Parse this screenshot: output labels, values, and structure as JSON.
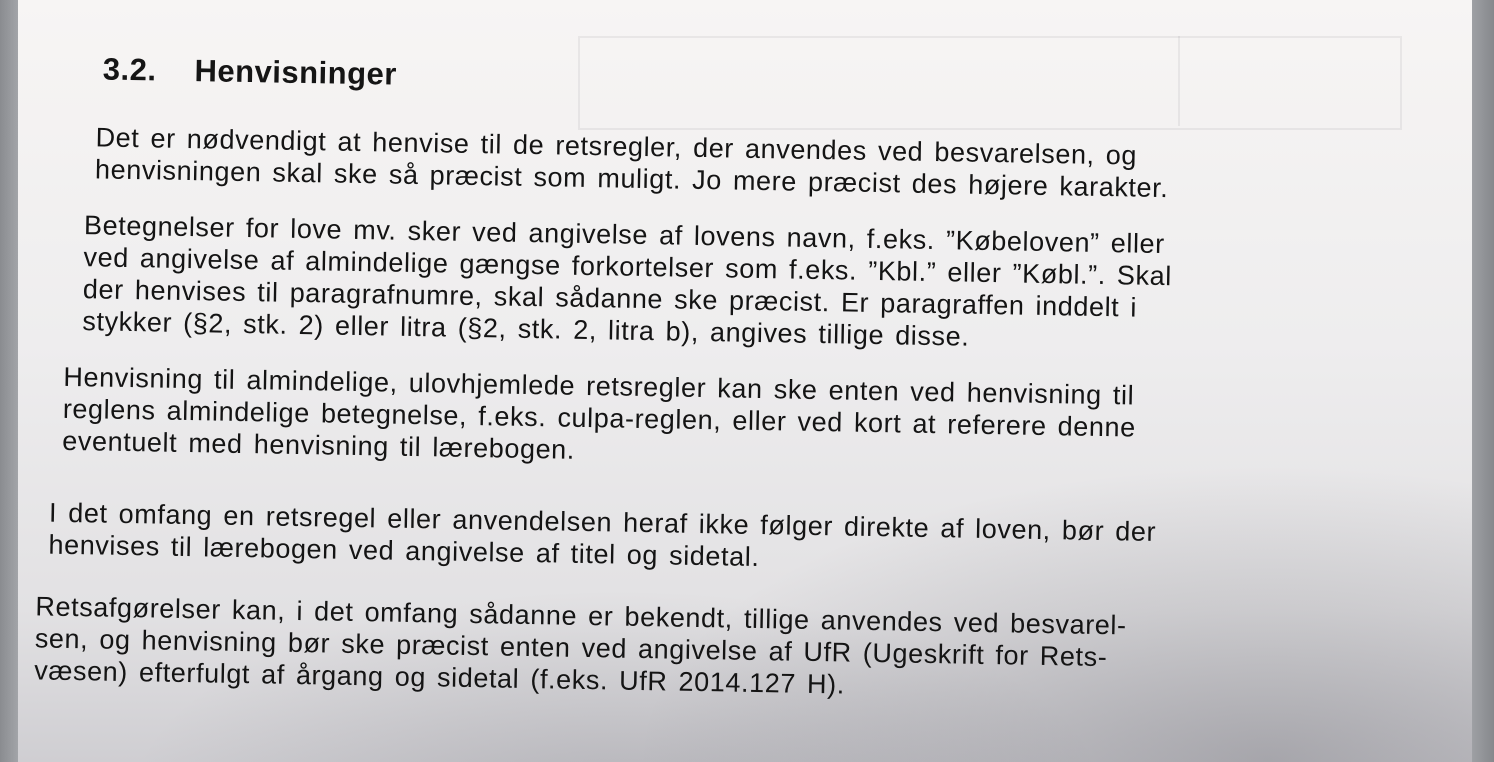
{
  "section": {
    "number": "3.2.",
    "title": "Henvisninger"
  },
  "paragraphs": [
    {
      "lines": [
        "Det er nødvendigt at henvise til de retsregler, der anvendes ved besvarelsen, og",
        "henvisningen skal ske så præcist som muligt. Jo mere præcist des højere karakter."
      ]
    },
    {
      "lines": [
        "Betegnelser for love mv. sker ved angivelse af lovens navn, f.eks. ”Købeloven” eller",
        "ved angivelse af almindelige gængse forkortelser som f.eks. ”Kbl.” eller ”Købl.”. Skal",
        "der henvises til paragrafnumre, skal sådanne ske præcist. Er paragraffen inddelt i",
        "stykker (§2, stk. 2) eller litra (§2, stk. 2, litra b), angives tillige disse."
      ]
    },
    {
      "lines": [
        "Henvisning til almindelige, ulovhjemlede retsregler kan ske enten ved henvisning til",
        "reglens almindelige betegnelse, f.eks. culpa-reglen, eller ved kort at referere denne",
        "eventuelt med henvisning til lærebogen."
      ]
    },
    {
      "lines": [
        "I det omfang en retsregel eller anvendelsen heraf ikke følger direkte af loven, bør der",
        "henvises til lærebogen ved angivelse af titel og sidetal."
      ]
    },
    {
      "lines": [
        "Retsafgørelser kan, i det omfang sådanne er bekendt, tillige anvendes ved besvarel-",
        "sen, og henvisning bør ske præcist enten ved angivelse af UfR (Ugeskrift for Rets-",
        "væsen) efterfulgt af årgang og sidetal (f.eks. UfR 2014.127 H)."
      ]
    }
  ]
}
